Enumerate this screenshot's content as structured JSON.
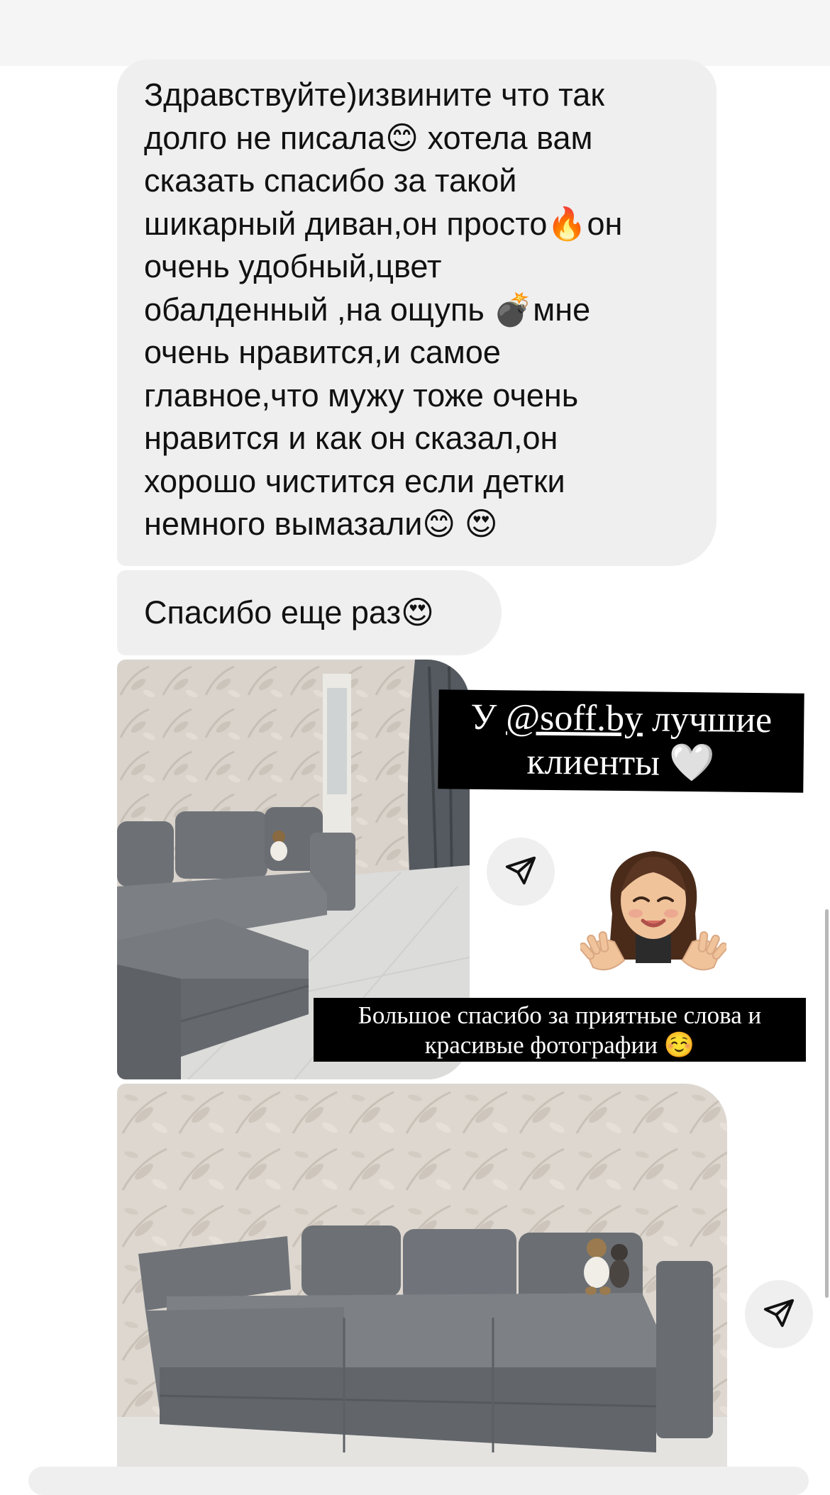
{
  "messages": {
    "m1_lines": [
      "Здравствуйте)извините что так",
      "долго не писала😊 хотела вам",
      "сказать спасибо за такой",
      "шикарный диван,он просто🔥он",
      "очень удобный,цвет",
      "обалденный ,на ощупь 💣мне",
      "очень нравится,и самое",
      "главное,что мужу тоже очень",
      "нравится и как он сказал,он",
      "хорошо чистится если детки",
      "немного вымазали😊 😍"
    ],
    "m2": "Спасибо еще раз😍"
  },
  "story": {
    "caption1_part1": "У ",
    "caption1_handle": "@soff.by",
    "caption1_part2": "  лучшие",
    "caption1_line2": "клиенты 🤍",
    "caption2_line1": "Большое спасибо за приятные слова и",
    "caption2_line2": "красивые фотографии ☺️"
  },
  "icons": {
    "share": "paper-plane-icon",
    "avatar": "memoji-avatar-icon"
  },
  "colors": {
    "bubble": "#efefef",
    "caption_bg": "#000000",
    "caption_text": "#ffffff",
    "sofa": "#6f7378"
  }
}
